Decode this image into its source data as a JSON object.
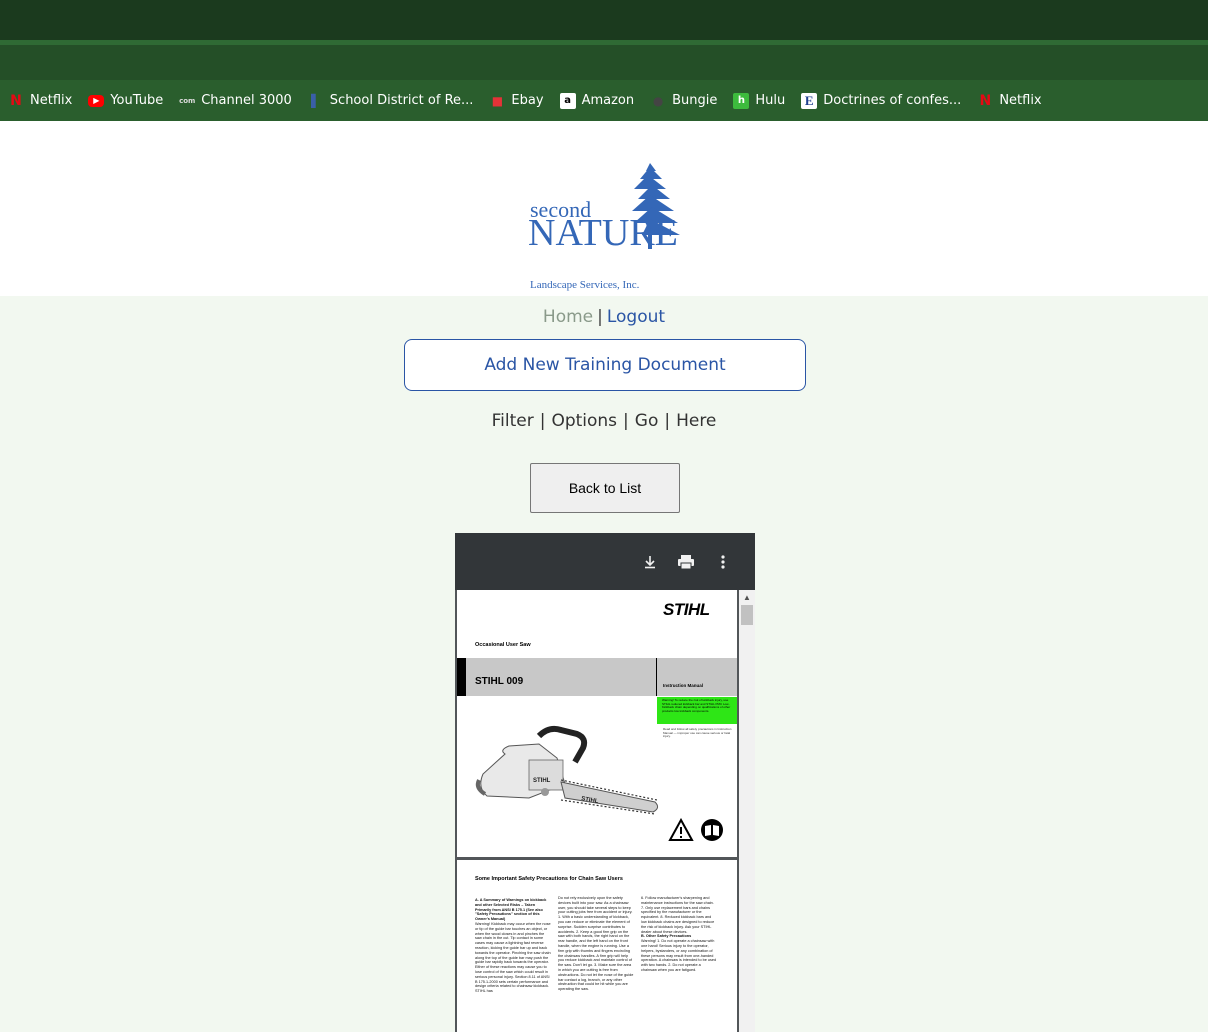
{
  "bookmarks": [
    {
      "label": "Netflix",
      "icon": "netflix-icon",
      "color": "#e50914"
    },
    {
      "label": "YouTube",
      "icon": "youtube-icon",
      "color": "#ff0000"
    },
    {
      "label": "Channel 3000",
      "icon": "channel3000-icon",
      "color": "#8a8a8a"
    },
    {
      "label": "School District of Re...",
      "icon": "school-district-icon",
      "color": "#3a5fa8"
    },
    {
      "label": "Ebay",
      "icon": "ebay-icon",
      "color": "#e53238"
    },
    {
      "label": "Amazon",
      "icon": "amazon-icon",
      "color": "#ffffff"
    },
    {
      "label": "Bungie",
      "icon": "bungie-icon",
      "color": "#444444"
    },
    {
      "label": "Hulu",
      "icon": "hulu-icon",
      "color": "#3dbb3d"
    },
    {
      "label": "Doctrines of confes...",
      "icon": "doctrines-icon",
      "color": "#1f3f8f"
    },
    {
      "label": "Netflix",
      "icon": "netflix-icon",
      "color": "#e50914"
    }
  ],
  "logo": {
    "line1": "second",
    "line2": "NATURE",
    "line3": "Landscape Services, Inc.",
    "color": "#3467b7"
  },
  "nav": {
    "home": "Home",
    "separator": "|",
    "logout": "Logout"
  },
  "add_button": "Add New Training Document",
  "filter_links": [
    "Filter",
    "Options",
    "Go",
    "Here"
  ],
  "back_button": "Back to List",
  "pdf": {
    "tools": [
      "download-icon",
      "print-icon",
      "more-vert-icon"
    ],
    "page1": {
      "brand": "STIHL",
      "subtitle": "Occasional User Saw",
      "model": "STIHL 009",
      "manual": "Instruction Manual",
      "warning_text": "Warning! To reduce the risk of kickback injury, use STIHL reduced kickback bar and STIHL PMC Low-Kickback chain depending on qualifications of other products low kickback components.",
      "note_text": "Read and follow all safety precautions in Instruction Manual — improper use can cause serious or fatal injury."
    },
    "page2": {
      "title": "Some Important Safety Precautions for Chain Saw Users",
      "col1_heading": "A. A Summary of Warnings on kickback and other Selected Risks – Taken Primarily from ANSI B 175.1 (See also \"Safety Precautions\" section of this Owner's Manual)",
      "col1_body": "Warning! Kickback may occur when the nose or tip of the guide bar touches an object, or when the wood closes in and pinches the saw chain in the cut. Tip contact in some cases may cause a lightning fast reverse reaction, kicking the guide bar up and back towards the operator. Pinching the saw chain along the top of the guide bar may push the guide bar rapidly back towards the operator. Either of these reactions may cause you to lose control of the saw which could result in serious personal injury. Section 8.11 of ANSI B 175.1-2000 sets certain performance and design criteria related to chainsaw kickback. STIHL has",
      "col2_body": "Do not rely exclusively upon the safety devices built into your saw. As a chainsaw user, you should take several steps to keep your cutting jobs free from accident or injury. 1. With a basic understanding of kickback, you can reduce or eliminate the element of surprise. Sudden surprise contributes to accidents. 2. Keep a good firm grip on the saw with both hands, the right hand on the rear handle, and the left hand on the front handle, when the engine is running. Use a firm grip with thumbs and fingers encircling the chainsaw handles. A firm grip will help you reduce kickback and maintain control of the saw. Don't let go. 3. Make sure the area in which you are cutting is free from obstructions. Do not let the nose of the guide bar contact a log, branch, or any other obstruction that could be hit while you are operating the saw.",
      "col3_body": "6. Follow manufacturer's sharpening and maintenance instructions for the saw chain. 7. Only use replacement bars and chains specified by the manufacturer or the equivalent. 8. Reduced kickback bars and low kickback chains are designed to reduce the risk of kickback injury. Ask your STIHL dealer about these devices.",
      "col3_heading": "B. Other Safety Precautions",
      "col3_body2": "Warning! 1. Do not operate a chainsaw with one hand! Serious injury to the operator, helpers, bystanders, or any combination of these persons may result from one-handed operation. A chainsaw is intended to be used with two hands. 2. Do not operate a chainsaw when you are fatigued."
    }
  }
}
